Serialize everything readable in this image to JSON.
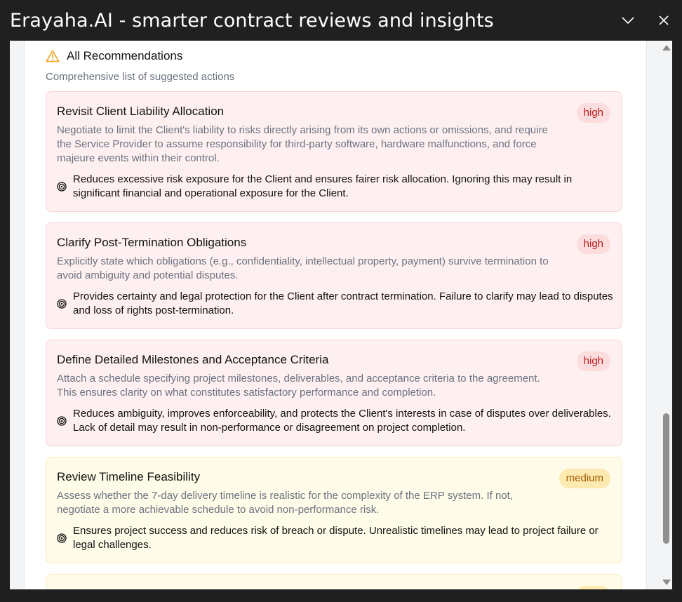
{
  "window": {
    "title": "Erayaha.AI - smarter contract reviews and insights"
  },
  "section": {
    "title": "All Recommendations",
    "subtitle": "Comprehensive list of suggested actions",
    "icon": "warning-icon",
    "icon_color": "#f5a623"
  },
  "colors": {
    "high_bg": "#fef0f0",
    "high_badge_text": "#b91c1c",
    "medium_bg": "#fefbe8",
    "medium_badge_text": "#a35a00"
  },
  "recommendations": [
    {
      "title": "Revisit Client Liability Allocation",
      "priority": "high",
      "description": "Negotiate to limit the Client's liability to risks directly arising from its own actions or omissions, and require the Service Provider to assume responsibility for third-party software, hardware malfunctions, and force majeure events within their control.",
      "impact": "Reduces excessive risk exposure for the Client and ensures fairer risk allocation. Ignoring this may result in significant financial and operational exposure for the Client."
    },
    {
      "title": "Clarify Post-Termination Obligations",
      "priority": "high",
      "description": "Explicitly state which obligations (e.g., confidentiality, intellectual property, payment) survive termination to avoid ambiguity and potential disputes.",
      "impact": "Provides certainty and legal protection for the Client after contract termination. Failure to clarify may lead to disputes and loss of rights post-termination."
    },
    {
      "title": "Define Detailed Milestones and Acceptance Criteria",
      "priority": "high",
      "description": "Attach a schedule specifying project milestones, deliverables, and acceptance criteria to the agreement. This ensures clarity on what constitutes satisfactory performance and completion.",
      "impact": "Reduces ambiguity, improves enforceability, and protects the Client's interests in case of disputes over deliverables. Lack of detail may result in non-performance or disagreement on project completion."
    },
    {
      "title": "Review Timeline Feasibility",
      "priority": "medium",
      "description": "Assess whether the 7-day delivery timeline is realistic for the complexity of the ERP system. If not, negotiate a more achievable schedule to avoid non-performance risk.",
      "impact": "Ensures project success and reduces risk of breach or dispute. Unrealistic timelines may lead to project failure or legal challenges."
    }
  ]
}
